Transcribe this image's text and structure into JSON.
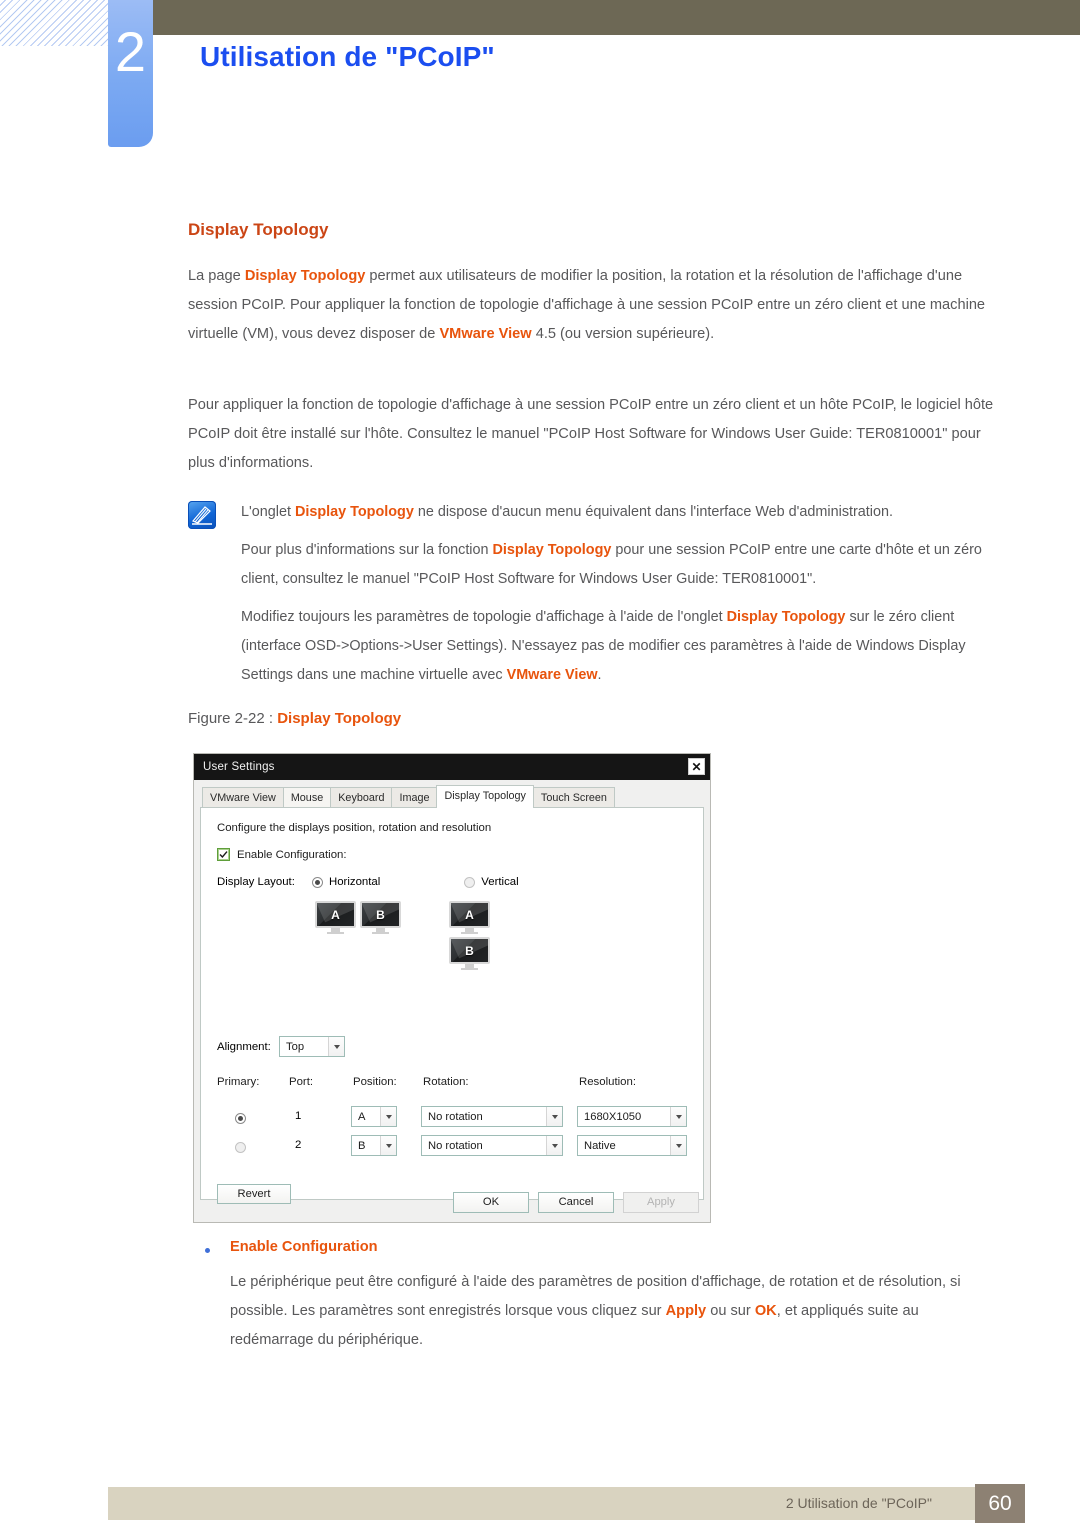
{
  "header": {
    "chapter_number": "2",
    "title": "Utilisation de \"PCoIP\"",
    "bar_color": "#6d6855",
    "title_color": "#1b4ef0",
    "tab_color": "#7ba9f2"
  },
  "section": {
    "heading": "Display Topology",
    "heading_color": "#cb4515",
    "paragraph_1": {
      "part_1": "La page ",
      "hl_1": "Display Topology",
      "part_2": " permet aux utilisateurs de modifier la position, la rotation et la résolution de l'affichage d'une session PCoIP. Pour appliquer la fonction de topologie d'affichage à une session PCoIP entre un zéro client et une machine virtuelle (VM), vous devez disposer de ",
      "hl_2": "VMware View",
      "part_3": " 4.5 (ou version supérieure)."
    },
    "paragraph_2": "Pour appliquer la fonction de topologie d'affichage à une session PCoIP entre un zéro client et un hôte PCoIP, le logiciel hôte PCoIP doit être installé sur l'hôte. Consultez le manuel \"PCoIP Host Software for Windows User Guide: TER0810001\" pour plus d'informations."
  },
  "note": {
    "icon_name": "note-pen-icon",
    "line_1": {
      "part_1": "L'onglet ",
      "hl_1": "Display Topology",
      "part_2": " ne dispose d'aucun menu équivalent dans l'interface Web d'administration."
    },
    "line_2": {
      "part_1": "Pour plus d'informations sur la fonction ",
      "hl_1": "Display Topology",
      "part_2": " pour une session PCoIP entre une carte d'hôte et un zéro client, consultez le manuel \"PCoIP Host Software for Windows User Guide: TER0810001\"."
    },
    "line_3": {
      "part_1": "Modifiez toujours les paramètres de topologie d'affichage à l'aide de l'onglet ",
      "hl_1": "Display Topology",
      "part_2": " sur le zéro client (interface OSD->Options->User Settings). N'essayez pas de modifier ces paramètres à l'aide de Windows Display Settings dans une machine virtuelle avec ",
      "hl_2": "VMware View",
      "part_3": "."
    }
  },
  "figure": {
    "caption_prefix": "Figure 2-22 : ",
    "caption_highlight": "Display Topology"
  },
  "dialog": {
    "title": "User Settings",
    "close_label": "✕",
    "tabs": [
      {
        "label": "VMware View",
        "active": false
      },
      {
        "label": "Mouse",
        "active": false
      },
      {
        "label": "Keyboard",
        "active": false
      },
      {
        "label": "Image",
        "active": false
      },
      {
        "label": "Display Topology",
        "active": true
      },
      {
        "label": "Touch Screen",
        "active": false
      }
    ],
    "panel_title": "Configure the displays position, rotation and resolution",
    "enable_configuration": {
      "label": "Enable Configuration:",
      "checked": true
    },
    "display_layout": {
      "label": "Display Layout:",
      "options": [
        {
          "label": "Horizontal",
          "selected": true
        },
        {
          "label": "Vertical",
          "selected": false
        }
      ],
      "horizontal_monitors": [
        "A",
        "B"
      ],
      "vertical_monitors": [
        "A",
        "B"
      ]
    },
    "alignment": {
      "label": "Alignment:",
      "value": "Top"
    },
    "grid": {
      "headers": [
        "Primary:",
        "Port:",
        "Position:",
        "Rotation:",
        "Resolution:"
      ],
      "rows": [
        {
          "primary": true,
          "port": "1",
          "position": "A",
          "rotation": "No rotation",
          "resolution": "1680X1050"
        },
        {
          "primary": false,
          "port": "2",
          "position": "B",
          "rotation": "No rotation",
          "resolution": "Native"
        }
      ]
    },
    "buttons": {
      "revert": "Revert",
      "ok": "OK",
      "cancel": "Cancel",
      "apply": "Apply"
    }
  },
  "bullet": {
    "title": "Enable Configuration",
    "text": {
      "part_1": "Le périphérique peut être configuré à l'aide des paramètres de position d'affichage, de rotation et de résolution, si possible. Les paramètres sont enregistrés lorsque vous cliquez sur ",
      "hl_1": "Apply",
      "part_2": " ou sur ",
      "hl_2": "OK",
      "part_3": ", et appliqués suite au redémarrage du périphérique."
    }
  },
  "footer": {
    "text": "2 Utilisation de \"PCoIP\"",
    "page_number": "60",
    "bar_color": "#d9d3c0",
    "pageno_color": "#8d8173"
  }
}
